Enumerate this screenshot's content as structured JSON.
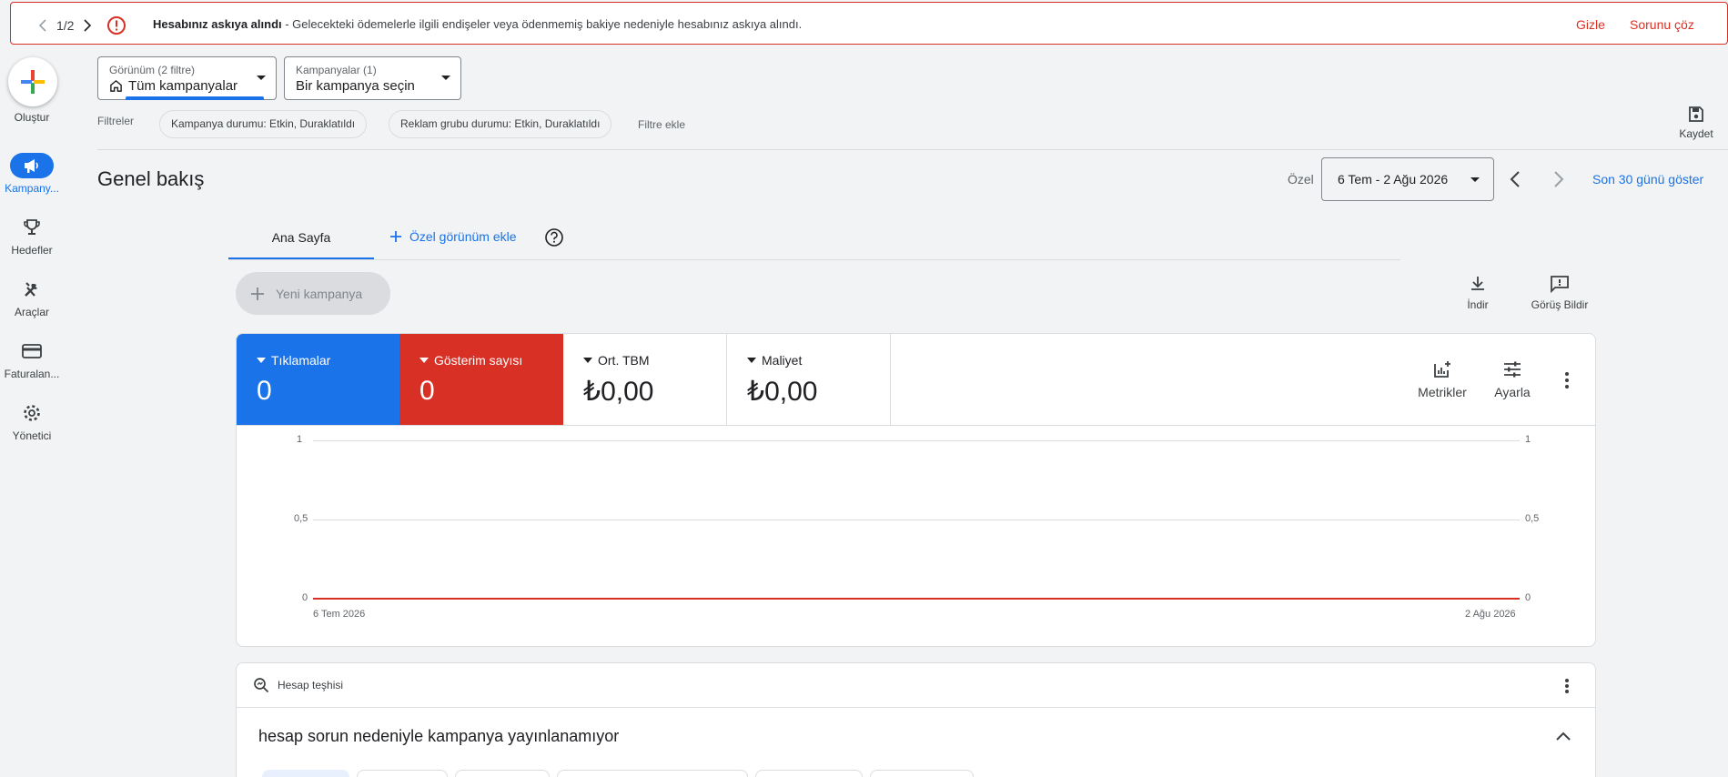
{
  "alert": {
    "pager": "1/2",
    "title": "Hesabınız askıya alındı",
    "message": " - Gelecekteki ödemelerle ilgili endişeler veya ödenmemiş bakiye nedeniyle hesabınız askıya alındı.",
    "hide_label": "Gizle",
    "fix_label": "Sorunu çöz"
  },
  "nav": {
    "create": "Oluştur",
    "items": [
      {
        "label": "Kampany..."
      },
      {
        "label": "Hedefler"
      },
      {
        "label": "Araçlar"
      },
      {
        "label": "Faturalan..."
      },
      {
        "label": "Yönetici"
      }
    ]
  },
  "view_selector": {
    "label": "Görünüm (2 filtre)",
    "value": "Tüm kampanyalar"
  },
  "campaign_selector": {
    "label": "Kampanyalar (1)",
    "value": "Bir kampanya seçin"
  },
  "filters": {
    "label": "Filtreler",
    "chips": [
      "Kampanya durumu: Etkin, Duraklatıldı",
      "Reklam grubu durumu: Etkin, Duraklatıldı"
    ],
    "add": "Filtre ekle"
  },
  "save_label": "Kaydet",
  "page_title": "Genel bakış",
  "date": {
    "custom_label": "Özel",
    "range": "6 Tem - 2 Ağu 2026",
    "last30": "Son 30 günü göster"
  },
  "tabs": {
    "home": "Ana Sayfa",
    "add_custom": "Özel görünüm ekle"
  },
  "new_campaign": "Yeni kampanya",
  "toolbar": {
    "download": "İndir",
    "feedback": "Görüş Bildir"
  },
  "metrics": [
    {
      "name": "Tıklamalar",
      "value": "0",
      "color": "#1a73e8"
    },
    {
      "name": "Gösterim sayısı",
      "value": "0",
      "color": "#d93025"
    },
    {
      "name": "Ort. TBM",
      "value": "₺0,00"
    },
    {
      "name": "Maliyet",
      "value": "₺0,00"
    }
  ],
  "metric_tools": {
    "metrics": "Metrikler",
    "adjust": "Ayarla"
  },
  "chart_data": {
    "type": "line",
    "x": [
      "6 Tem 2026",
      "2 Ağu 2026"
    ],
    "series": [
      {
        "values": [
          0,
          0
        ],
        "color": "#1a73e8"
      },
      {
        "values": [
          0,
          0
        ],
        "color": "#d93025"
      }
    ],
    "ylim": [
      0,
      1
    ],
    "y_ticks_left": [
      "1",
      "0,5",
      "0"
    ],
    "y_ticks_right": [
      "1",
      "0,5",
      "0"
    ],
    "x_tick_labels": [
      "6 Tem 2026",
      "2 Ağu 2026"
    ],
    "grid": true
  },
  "diagnosis": {
    "label": "Hesap teşhisi",
    "headline": "hesap sorun nedeniyle kampanya yayınlanamıyor"
  }
}
